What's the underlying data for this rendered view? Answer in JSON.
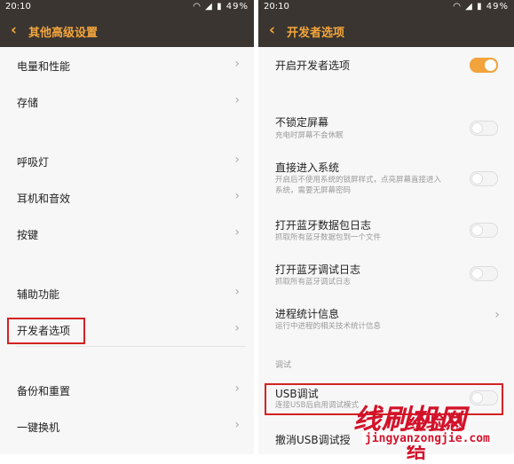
{
  "left": {
    "status": {
      "time": "20:10",
      "battery": "49%"
    },
    "title": "其他高级设置",
    "items": [
      {
        "label": "电量和性能"
      },
      {
        "label": "存储"
      },
      {
        "label": "呼吸灯"
      },
      {
        "label": "耳机和音效"
      },
      {
        "label": "按键"
      },
      {
        "label": "辅助功能"
      },
      {
        "label": "开发者选项"
      },
      {
        "label": "备份和重置"
      },
      {
        "label": "一键换机"
      }
    ]
  },
  "right": {
    "status": {
      "time": "20:10",
      "battery": "49%"
    },
    "title": "开发者选项",
    "dev_toggle": {
      "label": "开启开发者选项",
      "on": true
    },
    "items": [
      {
        "label": "不锁定屏幕",
        "sub": "充电时屏幕不会休眠"
      },
      {
        "label": "直接进入系统",
        "sub": "开启后不使用系统的锁屏样式，点亮屏幕直接进入",
        "sub2": "系统，需要无屏幕密码"
      },
      {
        "label": "打开蓝牙数据包日志",
        "sub": "抓取所有蓝牙数据包到一个文件"
      },
      {
        "label": "打开蓝牙调试日志",
        "sub": "抓取所有蓝牙调试日志"
      },
      {
        "label": "进程统计信息",
        "sub": "运行中进程的相关技术统计信息"
      }
    ],
    "section": "调试",
    "usb": {
      "label": "USB调试",
      "sub": "连接USB后启用调试模式"
    },
    "revoke": {
      "label": "撤消USB调试授"
    }
  },
  "watermark": {
    "text": "线刷机网",
    "overlay": "经验总结",
    "url": "jingyanzongjie.com"
  }
}
